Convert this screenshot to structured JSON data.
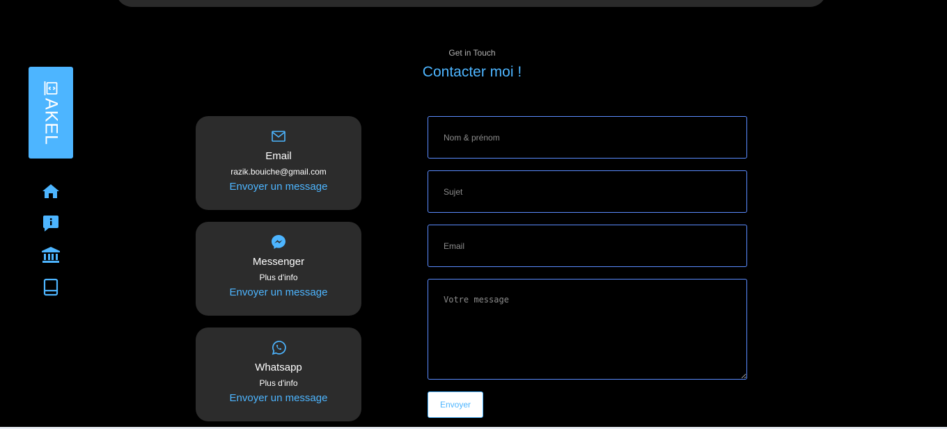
{
  "sidebar": {
    "logo_text": "AKEL",
    "nav": [
      {
        "icon": "home-icon"
      },
      {
        "icon": "info-icon"
      },
      {
        "icon": "bank-icon"
      },
      {
        "icon": "book-icon"
      }
    ]
  },
  "header": {
    "subtitle": "Get in Touch",
    "title": "Contacter moi !"
  },
  "contact_cards": [
    {
      "icon": "mail-icon",
      "title": "Email",
      "detail": "razik.bouiche@gmail.com",
      "link": "Envoyer un message"
    },
    {
      "icon": "messenger-icon",
      "title": "Messenger",
      "detail": "Plus d'info",
      "link": "Envoyer un message"
    },
    {
      "icon": "whatsapp-icon",
      "title": "Whatsapp",
      "detail": "Plus d'info",
      "link": "Envoyer un message"
    }
  ],
  "form": {
    "name_placeholder": "Nom & prénom",
    "subject_placeholder": "Sujet",
    "email_placeholder": "Email",
    "message_placeholder": "Votre message",
    "submit_label": "Envoyer"
  },
  "colors": {
    "accent": "#4db5ff",
    "card_bg": "#2c2c2c",
    "field_border": "#5b8cff",
    "background": "#000000"
  }
}
